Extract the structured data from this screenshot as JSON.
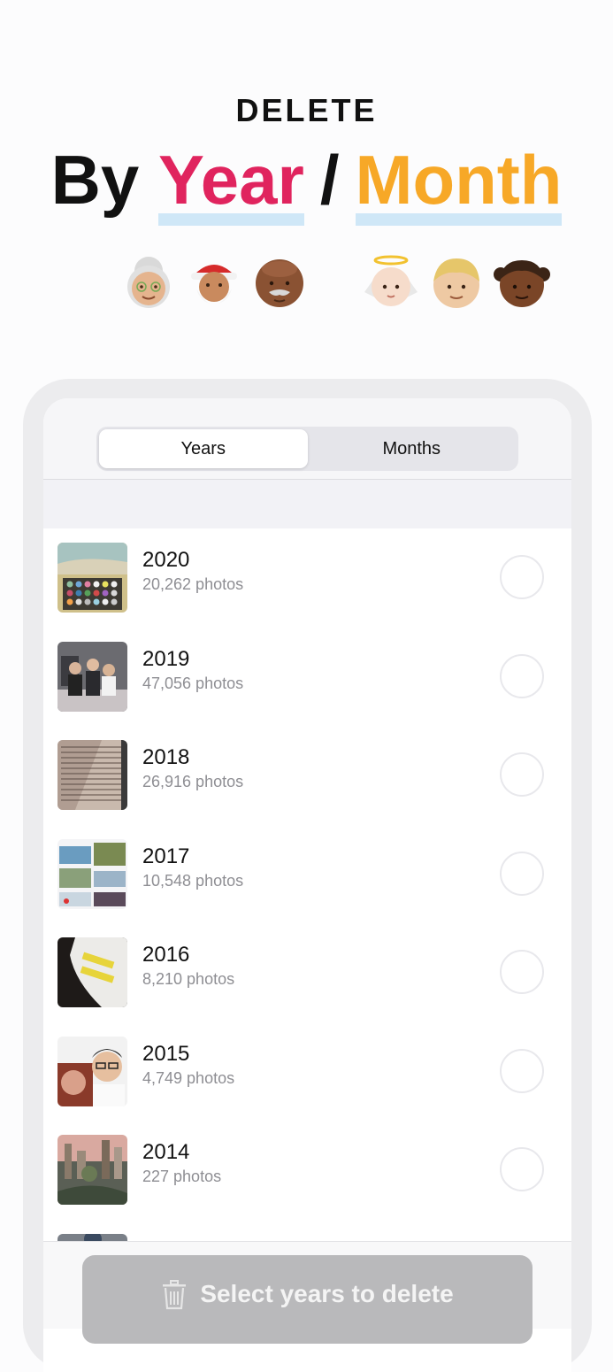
{
  "promo": {
    "kicker": "DELETE",
    "title_part1": "By",
    "title_year": "Year",
    "title_sep": "/",
    "title_month": "Month",
    "emoji_left": [
      "old-woman",
      "santa",
      "old-man"
    ],
    "emoji_right": [
      "baby-angel",
      "boy",
      "girl"
    ],
    "colors": {
      "year": "#e0245e",
      "month": "#f7a827",
      "underline": "#cfe7f7"
    }
  },
  "tabs": {
    "years": "Years",
    "months": "Months",
    "selected": "Years"
  },
  "years": [
    {
      "year": "2020",
      "count": "20,262 photos",
      "thumb": "beach-palette"
    },
    {
      "year": "2019",
      "count": "47,056 photos",
      "thumb": "group-photo"
    },
    {
      "year": "2018",
      "count": "26,916 photos",
      "thumb": "book-page"
    },
    {
      "year": "2017",
      "count": "10,548 photos",
      "thumb": "landscape-collage"
    },
    {
      "year": "2016",
      "count": "8,210 photos",
      "thumb": "yellow-tags"
    },
    {
      "year": "2015",
      "count": "4,749 photos",
      "thumb": "selfie"
    },
    {
      "year": "2014",
      "count": "227 photos",
      "thumb": "city-aerial"
    }
  ],
  "cta": {
    "label": "Select years to delete",
    "icon": "trash-icon"
  }
}
